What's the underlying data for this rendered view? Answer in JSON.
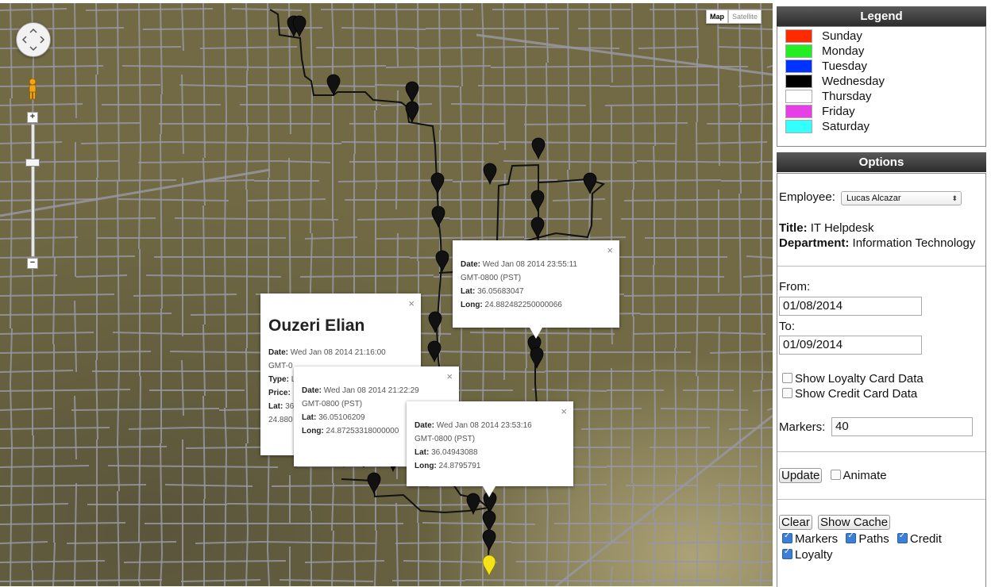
{
  "map": {
    "type_controls": {
      "map": "Map",
      "satellite": "Satellite",
      "active": "Map"
    },
    "zoom_in": "+",
    "zoom_out": "−",
    "route_color": "#111111",
    "marker_color": "#111111",
    "current_marker_color": "#f5e21a",
    "infowindows": [
      {
        "title": "Ouzeri Elian",
        "date_label": "Date:",
        "date": "Wed Jan 08 2014 21:16:00",
        "tz": "GMT-0",
        "type_label": "Type:",
        "type": "L",
        "price_label": "Price:",
        "lat_label": "Lat:",
        "lat": "36",
        "long_prefix": "24.880"
      },
      {
        "date_label": "Date:",
        "date": "Wed Jan 08 2014 21:22:29",
        "tz": "GMT-0800 (PST)",
        "lat_label": "Lat:",
        "lat": "36.05106209",
        "long_label": "Long:",
        "long": "24.87253318000000"
      },
      {
        "date_label": "Date:",
        "date": "Wed Jan 08 2014 23:55:11",
        "tz": "GMT-0800 (PST)",
        "lat_label": "Lat:",
        "lat": "36.05683047",
        "long_label": "Long:",
        "long": "24.882482250000066"
      },
      {
        "date_label": "Date:",
        "date": "Wed Jan 08 2014 23:53:16",
        "tz": "GMT-0800 (PST)",
        "lat_label": "Lat:",
        "lat": "36.04943088",
        "long_label": "Long:",
        "long": "24.8795791"
      }
    ],
    "close_glyph": "×"
  },
  "legend": {
    "title": "Legend",
    "items": [
      {
        "label": "Sunday",
        "color": "#ff2a00"
      },
      {
        "label": "Monday",
        "color": "#22ee22"
      },
      {
        "label": "Tuesday",
        "color": "#0033ff"
      },
      {
        "label": "Wednesday",
        "color": "#000000"
      },
      {
        "label": "Thursday",
        "color": "#ffffff"
      },
      {
        "label": "Friday",
        "color": "#e83ee8"
      },
      {
        "label": "Saturday",
        "color": "#33ffff"
      }
    ]
  },
  "options": {
    "title": "Options",
    "employee_label": "Employee:",
    "employee_value": "Lucas Alcazar",
    "title_label": "Title:",
    "title_value": "IT Helpdesk",
    "department_label": "Department:",
    "department_value": "Information Technology",
    "from_label": "From:",
    "from_value": "01/08/2014",
    "to_label": "To:",
    "to_value": "01/09/2014",
    "show_loyalty": {
      "label": "Show Loyalty Card Data",
      "checked": false
    },
    "show_credit": {
      "label": "Show Credit Card Data",
      "checked": false
    },
    "markers_label": "Markers:",
    "markers_value": "40",
    "update_label": "Update",
    "animate": {
      "label": "Animate",
      "checked": false
    },
    "clear_label": "Clear",
    "show_cache_label": "Show Cache",
    "layer_markers": {
      "label": "Markers",
      "checked": true
    },
    "layer_paths": {
      "label": "Paths",
      "checked": true
    },
    "layer_credit": {
      "label": "Credit",
      "checked": true
    },
    "layer_loyalty": {
      "label": "Loyalty",
      "checked": true
    }
  }
}
